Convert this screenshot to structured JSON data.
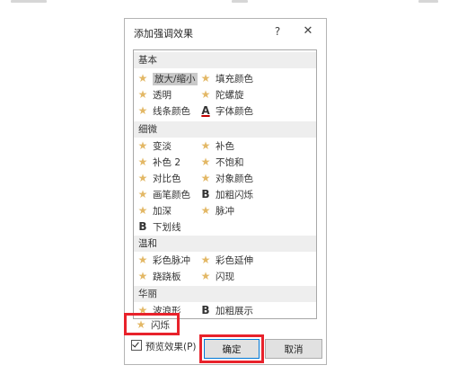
{
  "dialog": {
    "title": "添加强调效果",
    "help_glyph": "?",
    "close_glyph": "✕"
  },
  "groups": [
    {
      "header": "基本",
      "items": [
        {
          "label": "放大/缩小",
          "icon": "star-icon",
          "selected": true
        },
        {
          "label": "填充颜色",
          "icon": "star-icon"
        },
        {
          "label": "透明",
          "icon": "star-icon"
        },
        {
          "label": "陀螺旋",
          "icon": "star-icon"
        },
        {
          "label": "线条颜色",
          "icon": "star-icon"
        },
        {
          "label": "字体颜色",
          "icon": "font-color-icon",
          "glyph": "A"
        }
      ]
    },
    {
      "header": "细微",
      "items": [
        {
          "label": "变淡",
          "icon": "star-icon"
        },
        {
          "label": "补色",
          "icon": "star-icon"
        },
        {
          "label": "补色 2",
          "icon": "star-icon"
        },
        {
          "label": "不饱和",
          "icon": "star-icon"
        },
        {
          "label": "对比色",
          "icon": "star-icon"
        },
        {
          "label": "对象颜色",
          "icon": "star-icon"
        },
        {
          "label": "画笔颜色",
          "icon": "star-icon"
        },
        {
          "label": "加粗闪烁",
          "icon": "bold-icon",
          "glyph": "B"
        },
        {
          "label": "加深",
          "icon": "star-icon"
        },
        {
          "label": "脉冲",
          "icon": "star-icon"
        },
        {
          "label": "下划线",
          "icon": "bold-icon",
          "glyph": "B"
        }
      ]
    },
    {
      "header": "温和",
      "items": [
        {
          "label": "彩色脉冲",
          "icon": "star-icon"
        },
        {
          "label": "彩色延伸",
          "icon": "star-icon"
        },
        {
          "label": "跷跷板",
          "icon": "star-icon"
        },
        {
          "label": "闪现",
          "icon": "star-icon"
        }
      ]
    },
    {
      "header": "华丽",
      "items": [
        {
          "label": "波浪形",
          "icon": "star-icon"
        },
        {
          "label": "加粗展示",
          "icon": "bold-icon",
          "glyph": "B"
        },
        {
          "label": "闪烁",
          "icon": "star-icon",
          "highlighted": true
        }
      ]
    }
  ],
  "preview_checkbox": {
    "label": "预览效果(P)",
    "checked": true
  },
  "buttons": {
    "ok": "确定",
    "cancel": "取消"
  },
  "colors": {
    "star": "#e3b866",
    "highlight": "#e8222b",
    "selected": "#c9c9c9",
    "header_bg": "#eeeeee"
  }
}
